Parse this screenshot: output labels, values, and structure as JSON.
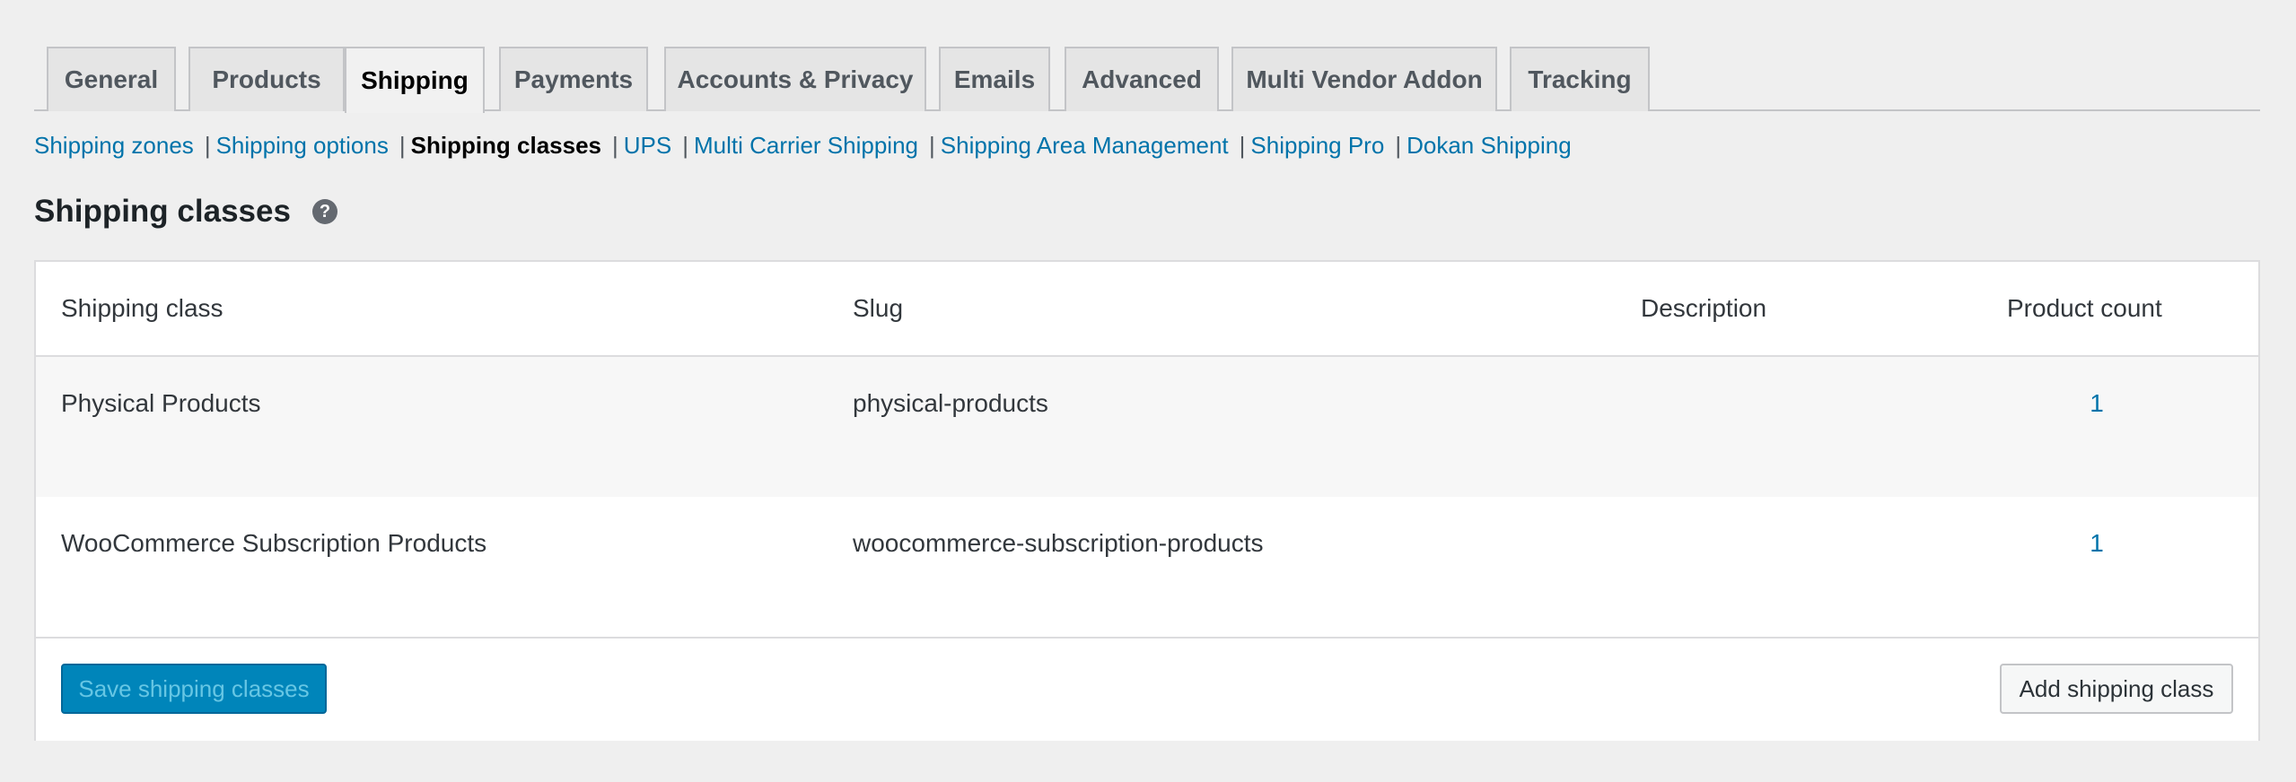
{
  "tabs": [
    {
      "label": "General"
    },
    {
      "label": "Products"
    },
    {
      "label": "Shipping"
    },
    {
      "label": "Payments"
    },
    {
      "label": "Accounts & Privacy"
    },
    {
      "label": "Emails"
    },
    {
      "label": "Advanced"
    },
    {
      "label": "Multi Vendor Addon"
    },
    {
      "label": "Tracking"
    }
  ],
  "subnav": {
    "items": [
      {
        "label": "Shipping zones"
      },
      {
        "label": "Shipping options"
      },
      {
        "label": "Shipping classes"
      },
      {
        "label": "UPS"
      },
      {
        "label": "Multi Carrier Shipping"
      },
      {
        "label": "Shipping Area Management"
      },
      {
        "label": "Shipping Pro"
      },
      {
        "label": "Dokan Shipping"
      }
    ],
    "separator": "|"
  },
  "page": {
    "title": "Shipping classes",
    "help_glyph": "?"
  },
  "table": {
    "headers": {
      "shipping_class": "Shipping class",
      "slug": "Slug",
      "description": "Description",
      "product_count": "Product count"
    },
    "rows": [
      {
        "name": "Physical Products",
        "slug": "physical-products",
        "description": "",
        "count": "1"
      },
      {
        "name": "WooCommerce Subscription Products",
        "slug": "woocommerce-subscription-products",
        "description": "",
        "count": "1"
      }
    ]
  },
  "footer": {
    "save_label": "Save shipping classes",
    "add_label": "Add shipping class"
  },
  "colors": {
    "link": "#0073aa",
    "primary_button": "#0085ba",
    "background": "#efefef"
  }
}
